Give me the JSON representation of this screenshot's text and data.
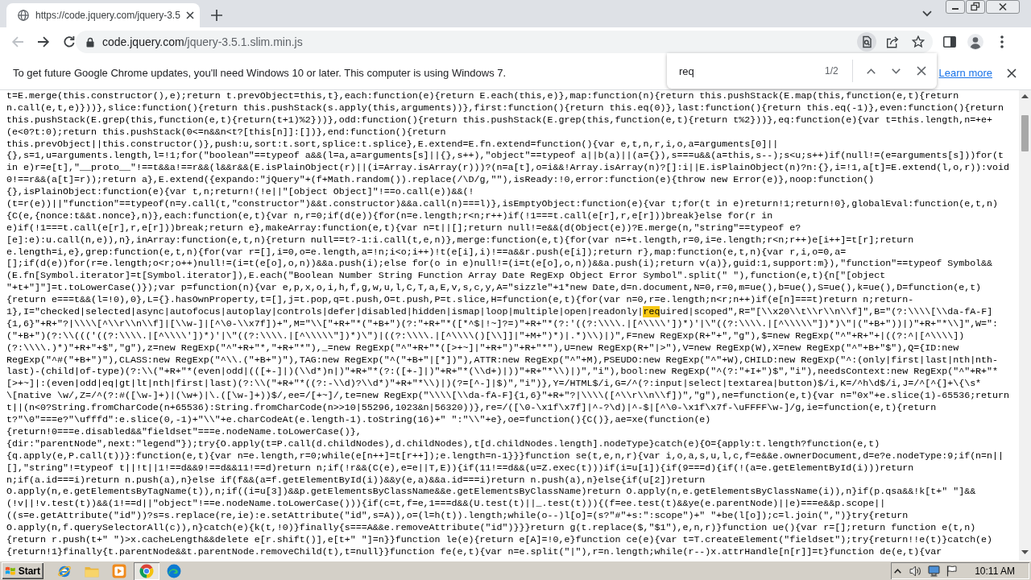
{
  "browser": {
    "tab": {
      "title": "https://code.jquery.com/jquery-3.5",
      "selected": true
    },
    "nav": [
      {
        "kind": "back",
        "disabled": true
      },
      {
        "kind": "forward",
        "disabled": false
      },
      {
        "kind": "reload",
        "disabled": false
      }
    ],
    "address": {
      "domain": "code.jquery.com",
      "path": "/jquery-3.5.1.slim.min.js"
    }
  },
  "infobar": {
    "message": "To get future Google Chrome updates, you'll need Windows 10 or later. This computer is using Windows 7.",
    "link": "Learn more"
  },
  "find_bar": {
    "query": "req",
    "count": "1/2"
  },
  "code_lines": [
    "t=E.merge(this.constructor(),e);return t.prevObject=this,t},each:function(e){return E.each(this,e)},map:function(n){return this.pushStack(E.map(this,function(e,t){return",
    "n.call(e,t,e)}))},slice:function(){return this.pushStack(s.apply(this,arguments))},first:function(){return this.eq(0)},last:function(){return this.eq(-1)},even:function(){return",
    "this.pushStack(E.grep(this,function(e,t){return(t+1)%2}))},odd:function(){return this.pushStack(E.grep(this,function(e,t){return t%2}))},eq:function(e){var t=this.length,n=+e+",
    "(e<0?t:0);return this.pushStack(0<=n&&n<t?[this[n]]:[])},end:function(){return",
    "this.prevObject||this.constructor()},push:u,sort:t.sort,splice:t.splice},E.extend=E.fn.extend=function(){var e,t,n,r,i,o,a=arguments[0]||",
    "{},s=1,u=arguments.length,l=!1;for(\"boolean\"==typeof a&&(l=a,a=arguments[s]||{},s++),\"object\"==typeof a||b(a)||(a={}),s===u&&(a=this,s--);s<u;s++)if(null!=(e=arguments[s]))for(t",
    "in e)r=e[t],\"__proto__\"!==t&&a!==r&&(l&&r&&(E.isPlainObject(r)||(i=Array.isArray(r)))?(n=a[t],o=i&&!Array.isArray(n)?[]:i||E.isPlainObject(n)?n:{},i=!1,a[t]=E.extend(l,o,r)):void",
    "0!==r&&(a[t]=r));return a},E.extend({expando:\"jQuery\"+(f+Math.random()).replace(/\\D/g,\"\"),isReady:!0,error:function(e){throw new Error(e)},noop:function()",
    "{},isPlainObject:function(e){var t,n;return!(!e||\"[object Object]\"!==o.call(e))&&(!",
    "(t=r(e))||\"function\"==typeof(n=y.call(t,\"constructor\")&&t.constructor)&&a.call(n)===l)},isEmptyObject:function(e){var t;for(t in e)return!1;return!0},globalEval:function(e,t,n)",
    "{C(e,{nonce:t&&t.nonce},n)},each:function(e,t){var n,r=0;if(d(e)){for(n=e.length;r<n;r++)if(!1===t.call(e[r],r,e[r]))break}else for(r in",
    "e)if(!1===t.call(e[r],r,e[r]))break;return e},makeArray:function(e,t){var n=t||[];return null!=e&&(d(Object(e))?E.merge(n,\"string\"==typeof e?",
    "[e]:e):u.call(n,e)),n},inArray:function(e,t,n){return null==t?-1:i.call(t,e,n)},merge:function(e,t){for(var n=+t.length,r=0,i=e.length;r<n;r++)e[i++]=t[r];return",
    "e.length=i,e},grep:function(e,t,n){for(var r=[],i=0,o=e.length,a=!n;i<o;i++)!t(e[i],i)!==a&&r.push(e[i]);return r},map:function(e,t,n){var r,i,o=0,a=",
    "[];if(d(e))for(r=e.length;o<r;o++)null!=(i=t(e[o],o,n))&&a.push(i);else for(o in e)null!=(i=t(e[o],o,n))&&a.push(i);return v(a)},guid:1,support:m}),\"function\"==typeof Symbol&&",
    "(E.fn[Symbol.iterator]=t[Symbol.iterator]),E.each(\"Boolean Number String Function Array Date RegExp Object Error Symbol\".split(\" \"),function(e,t){n[\"[object",
    "\"+t+\"]\"]=t.toLowerCase()});var p=function(n){var e,p,x,o,i,h,f,g,w,u,l,C,T,a,E,v,s,c,y,A=\"sizzle\"+1*new Date,d=n.document,N=0,r=0,m=ue(),b=ue(),S=ue(),k=ue(),D=function(e,t)",
    "{return e===t&&(l=!0),0},L={}.hasOwnProperty,t=[],j=t.pop,q=t.push,O=t.push,P=t.slice,H=function(e,t){for(var n=0,r=e.length;n<r;n++)if(e[n]===t)return n;return-",
    {
      "segments": [
        {
          "text": "1},I=\"checked|selected|async|autofocus|autoplay|controls|defer|disabled|hidden|ismap|loop|multiple|open|readonly|",
          "highlighted": false
        },
        {
          "text": "req",
          "highlighted": true
        },
        {
          "text": "uired|scoped\",R=\"[\\\\x20\\\\t\\\\r\\\\n\\\\f]\",B=\"(?:\\\\\\\\[\\\\da-fA-F]",
          "highlighted": false
        }
      ]
    },
    "{1,6}\"+R+\"?|\\\\\\\\[^\\\\r\\\\n\\\\f]|[\\\\w-]|[^\\0-\\\\x7f])+\",M=\"\\\\[\"+R+\"*(\"+B+\")(?:\"+R+\"*([*^$|!~]?=)\"+R+\"*(?:'((?:\\\\\\\\.|[^\\\\\\\\'])*)'|\\\"((?:\\\\\\\\.|[^\\\\\\\\\\\"])*)\\\"|(\"+B+\"))|)\"+R+\"*\\\\]\",W=\":",
    "(\"+B+\")(?:\\\\((('((?:\\\\\\\\.|[^\\\\\\\\'])*)'|\\\"((?:\\\\\\\\.|[^\\\\\\\\\\\"])*)\\\")|((?:\\\\\\\\.|[^\\\\\\\\()[\\\\]]|\"+M+\")*)|.*)\\\\)|)\",F=new RegExp(R+\"+\",\"g\"),$=new RegExp(\"^\"+R+\"+|((?:^|[^\\\\\\\\])",
    "(?:\\\\\\\\.)*)\"+R+\"+$\",\"g\"),z=new RegExp(\"^\"+R+\"*,\"+R+\"*\"),_=new RegExp(\"^\"+R+\"*([>+~]|\"+R+\")\"+R+\"*\"),U=new RegExp(R+\"|>\"),V=new RegExp(W),X=new RegExp(\"^\"+B+\"$\"),Q={ID:new",
    "RegExp(\"^#(\"+B+\")\"),CLASS:new RegExp(\"^\\\\.(\"+B+\")\"),TAG:new RegExp(\"^(\"+B+\"|[*])\"),ATTR:new RegExp(\"^\"+M),PSEUDO:new RegExp(\"^\"+W),CHILD:new RegExp(\"^:(only|first|last|nth|nth-",
    "last)-(child|of-type)(?:\\\\(\"+R+\"*(even|odd|(([+-]|)(\\\\d*)n|)\"+R+\"*(?:([+-]|)\"+R+\"*(\\\\d+)|))\"+R+\"*\\\\)|)\",\"i\"),bool:new RegExp(\"^(?:\"+I+\")$\",\"i\"),needsContext:new RegExp(\"^\"+R+\"*",
    "[>+~]|:(even|odd|eq|gt|lt|nth|first|last)(?:\\\\(\"+R+\"*((?:-\\\\d)?\\\\d*)\"+R+\"*\\\\)|)(?=[^-]|$)\",\"i\")},Y=/HTML$/i,G=/^(?:input|select|textarea|button)$/i,K=/^h\\d$/i,J=/^[^{]+\\{\\s*",
    "\\[native \\w/,Z=/^(?:#([\\w-]+)|(\\w+)|\\.([\\w-]+))$/,ee=/[+~]/,te=new RegExp(\"\\\\\\\\[\\\\da-fA-F]{1,6}\"+R+\"?|\\\\\\\\([^\\\\r\\\\n\\\\f])\",\"g\"),ne=function(e,t){var n=\"0x\"+e.slice(1)-65536;return",
    "t||(n<0?String.fromCharCode(n+65536):String.fromCharCode(n>>10|55296,1023&n|56320))},re=/([\\0-\\x1f\\x7f]|^-?\\d)|^-$|[^\\0-\\x1f\\x7f-\\uFFFF\\w-]/g,ie=function(e,t){return",
    "t?\"\\0\"===e?\"\\ufffd\":e.slice(0,-1)+\"\\\\\"+e.charCodeAt(e.length-1).toString(16)+\" \":\"\\\\\"+e},oe=function(){C()},ae=xe(function(e)",
    "{return!0===e.disabled&&\"fieldset\"===e.nodeName.toLowerCase()},",
    "{dir:\"parentNode\",next:\"legend\"});try{O.apply(t=P.call(d.childNodes),d.childNodes),t[d.childNodes.length].nodeType}catch(e){O={apply:t.length?function(e,t)",
    "{q.apply(e,P.call(t))}:function(e,t){var n=e.length,r=0;while(e[n++]=t[r++]);e.length=n-1}}}function se(t,e,n,r){var i,o,a,s,u,l,c,f=e&&e.ownerDocument,d=e?e.nodeType:9;if(n=n||",
    "[],\"string\"!=typeof t||!t||1!==d&&9!==d&&11!==d)return n;if(!r&&(C(e),e=e||T,E)){if(11!==d&&(u=Z.exec(t)))if(i=u[1]){if(9===d){if(!(a=e.getElementById(i)))return",
    "n;if(a.id===i)return n.push(a),n}else if(f&&(a=f.getElementById(i))&&y(e,a)&&a.id===i)return n.push(a),n}else{if(u[2])return",
    "O.apply(n,e.getElementsByTagName(t)),n;if((i=u[3])&&p.getElementsByClassName&&e.getElementsByClassName)return O.apply(n,e.getElementsByClassName(i)),n}if(p.qsa&&!k[t+\" \"]&&",
    "(!v||!v.test(t))&&(1!==d||\"object\"!==e.nodeName.toLowerCase())){if(c=t,f=e,1===d&&(U.test(t)||_.test(t))){(f=ee.test(t)&&ye(e.parentNode)||e)===e&&p.scope||",
    "((s=e.getAttribute(\"id\"))?s=s.replace(re,ie):e.setAttribute(\"id\",s=A)),o=(l=h(t)).length;while(o--)l[o]=(s?\"#\"+s:\":scope\")+\" \"+be(l[o]);c=l.join(\",\")}try{return",
    "O.apply(n,f.querySelectorAll(c)),n}catch(e){k(t,!0)}finally{s===A&&e.removeAttribute(\"id\")}}}return g(t.replace($,\"$1\"),e,n,r)}function ue(){var r=[];return function e(t,n)",
    "{return r.push(t+\" \")>x.cacheLength&&delete e[r.shift()],e[t+\" \"]=n}}function le(e){return e[A]=!0,e}function ce(e){var t=T.createElement(\"fieldset\");try{return!!e(t)}catch(e)",
    "{return!1}finally{t.parentNode&&t.parentNode.removeChild(t),t=null}}function fe(e,t){var n=e.split(\"|\"),r=n.length;while(r--)x.attrHandle[n[r]]=t}function de(e,t){var"
  ],
  "taskbar": {
    "start": "Start",
    "apps": [
      {
        "kind": "ie",
        "selected": false
      },
      {
        "kind": "folder",
        "selected": false
      },
      {
        "kind": "media",
        "selected": false
      },
      {
        "kind": "chrome",
        "selected": true
      },
      {
        "kind": "edge",
        "selected": false
      }
    ],
    "clock": "10:11 AM"
  }
}
